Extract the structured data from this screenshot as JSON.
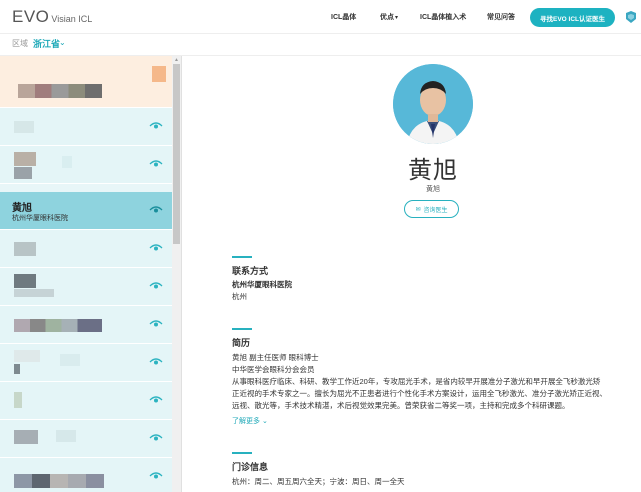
{
  "header": {
    "logo_main": "EVO",
    "logo_sub": "Visian ICL",
    "nav": [
      "ICL晶体",
      "优点",
      "ICL晶体植入术",
      "常见问答"
    ],
    "cta": "寻找EVO ICL认证医生"
  },
  "region": {
    "label": "区域",
    "value": "浙江省"
  },
  "sidebar": {
    "active_doctor": {
      "name": "黄旭",
      "hospital": "杭州华厦眼科医院"
    }
  },
  "doctor": {
    "name": "黄旭",
    "title": "黄旭",
    "consult_label": "咨询医生"
  },
  "contact": {
    "heading": "联系方式",
    "hospital": "杭州华厦眼科医院",
    "city": "杭州"
  },
  "resume": {
    "heading": "简历",
    "lines": [
      "黄旭 副主任医师 眼科博士",
      "中华医学会眼科分会会员",
      "从事眼科医疗临床、科研、教学工作近20年，专攻屈光手术，是省内较早开展准分子激光和早开展全飞秒激光矫",
      "正近视的手术专家之一。擅长为屈光不正患者进行个性化手术方案设计，运用全飞秒激光、准分子激光矫正近视、",
      "远视、散光等，手术技术精湛，术后视觉效果完美。曾荣获省二等奖一项，主持和完成多个科研课题。"
    ],
    "more": "了解更多"
  },
  "schedule": {
    "heading": "门诊信息",
    "text": "杭州：周二、周五周六全天；宁波：周日、周一全天"
  },
  "colors": {
    "accent": "#28b1bf",
    "sidebar_bg": "#e4f5f7",
    "active": "#8ed3de"
  }
}
